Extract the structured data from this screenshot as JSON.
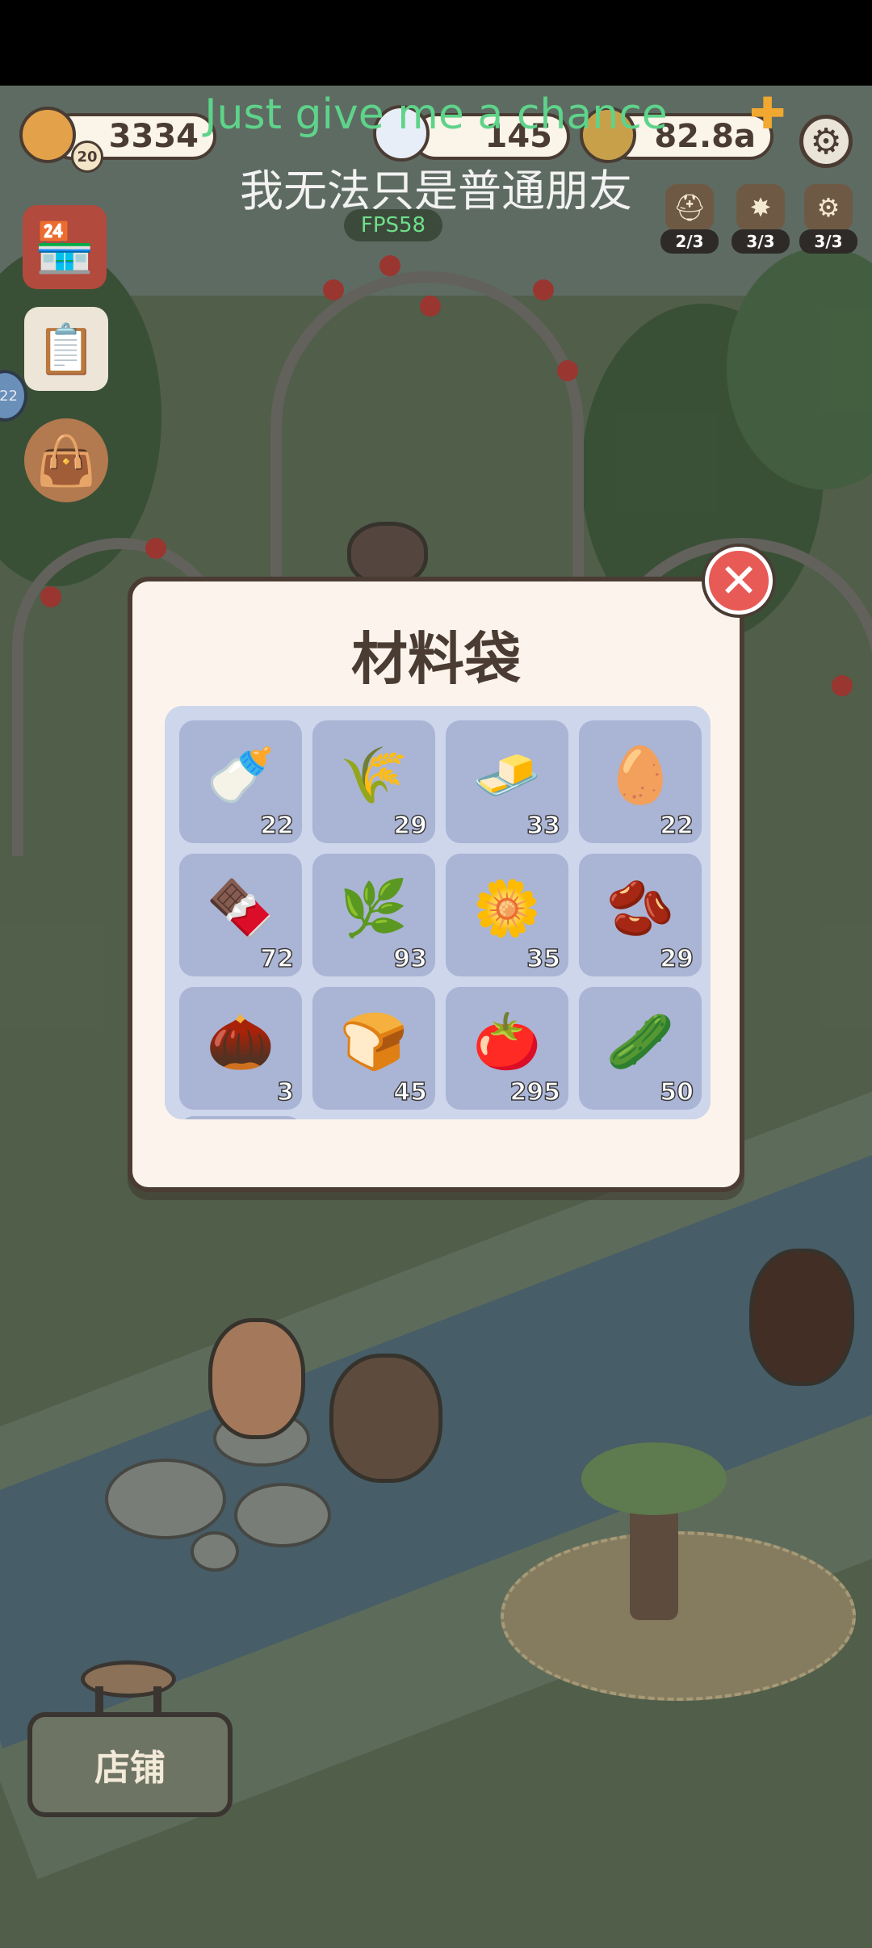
{
  "hud": {
    "currency": "3334",
    "level": "20",
    "gems": "145",
    "gold": "82.8a",
    "plus_symbol": "✚",
    "queue": [
      {
        "icon": "helmet-icon",
        "count": "2/3"
      },
      {
        "icon": "fireworks-icon",
        "count": "3/3"
      },
      {
        "icon": "cannon-icon",
        "count": "3/3"
      }
    ]
  },
  "overlay": {
    "subtitle_en": "Just give me a chance",
    "subtitle_zh": "我无法只是普通朋友",
    "fps": "FPS58",
    "side_badge": "22"
  },
  "modal": {
    "title": "材料袋",
    "close_symbol": "✕",
    "items": [
      {
        "name": "milk",
        "glyph": "🍼",
        "count": "22"
      },
      {
        "name": "wheat-flour",
        "glyph": "🌾",
        "count": "29"
      },
      {
        "name": "butter",
        "glyph": "🧈",
        "count": "33"
      },
      {
        "name": "eggs",
        "glyph": "🥚",
        "count": "22"
      },
      {
        "name": "chocolate",
        "glyph": "🍫",
        "count": "72"
      },
      {
        "name": "mint-leaf",
        "glyph": "🌿",
        "count": "93"
      },
      {
        "name": "vanilla",
        "glyph": "🌼",
        "count": "35"
      },
      {
        "name": "coffee-beans",
        "glyph": "🫘",
        "count": "29"
      },
      {
        "name": "nuts",
        "glyph": "🌰",
        "count": "3"
      },
      {
        "name": "bread-rolls",
        "glyph": "🍞",
        "count": "45"
      },
      {
        "name": "tomato",
        "glyph": "🍅",
        "count": "295"
      },
      {
        "name": "cucumber",
        "glyph": "🥒",
        "count": "50"
      }
    ]
  },
  "bottom": {
    "shop_label": "店铺"
  },
  "colors": {
    "panel_bg": "#fcf4ec",
    "grid_bg": "#cdd6ea",
    "slot_bg": "#aab4d5",
    "outline": "#4a3c33",
    "close_red": "#e85a55",
    "subtitle_green": "#5ed38a"
  }
}
